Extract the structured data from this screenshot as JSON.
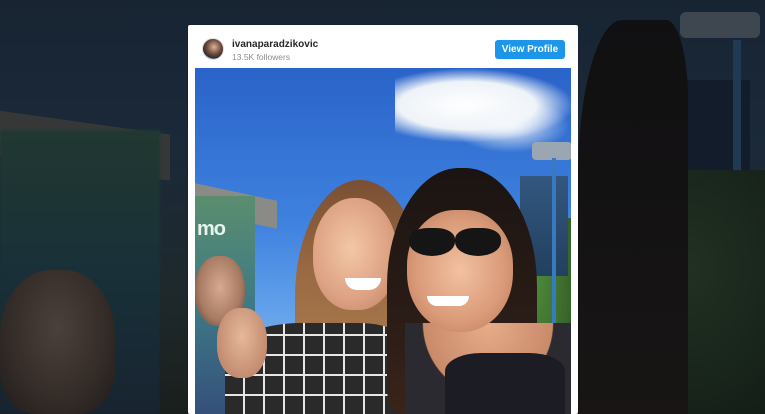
{
  "embed": {
    "username": "ivanaparadzikovic",
    "followers": "13.5K followers",
    "view_profile_label": "View Profile",
    "accent_color": "#1c96e9"
  },
  "photo": {
    "booth_sign_text": "mo"
  }
}
